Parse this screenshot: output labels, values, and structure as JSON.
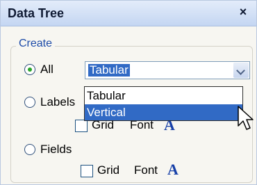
{
  "panel": {
    "title": "Data Tree",
    "close_glyph": "×"
  },
  "group": {
    "label": "Create"
  },
  "options": {
    "all": {
      "label": "All",
      "checked": true
    },
    "labels": {
      "label": "Labels",
      "checked": false,
      "grid_label": "Grid",
      "font_label": "Font",
      "font_glyph": "A"
    },
    "fields": {
      "label": "Fields",
      "checked": false,
      "grid_label": "Grid",
      "font_label": "Font",
      "font_glyph": "A"
    }
  },
  "combo": {
    "value": "Tabular",
    "items": [
      "Tabular",
      "Vertical"
    ],
    "highlighted": "Vertical"
  },
  "colors": {
    "accent": "#316ac5",
    "radio_checked": "#2aa52a",
    "font_icon": "#1740a8"
  }
}
